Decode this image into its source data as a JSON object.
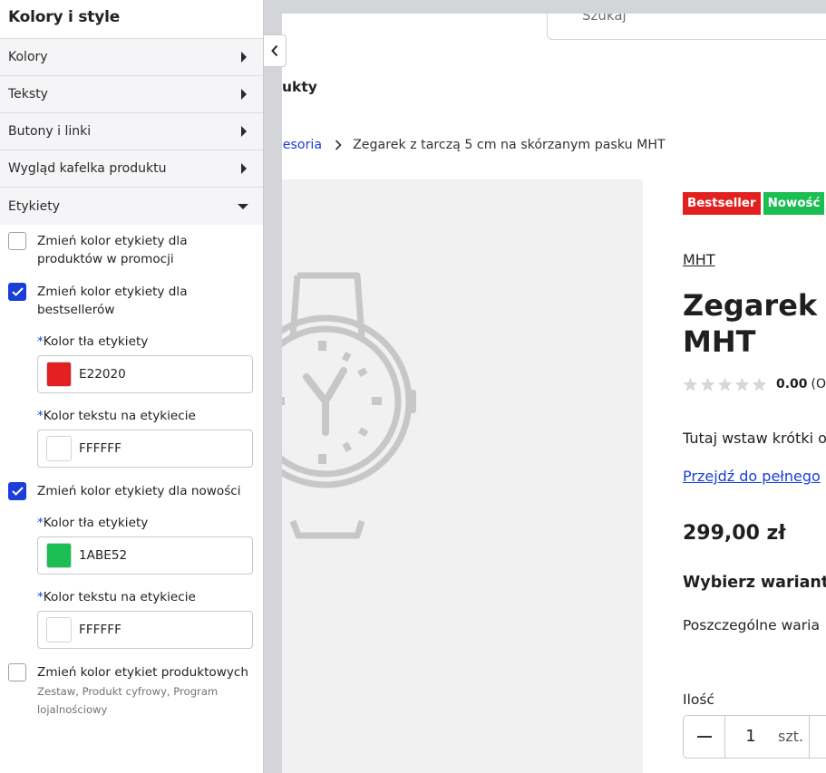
{
  "panel": {
    "title": "Kolory i style",
    "sections": [
      "Kolory",
      "Teksty",
      "Butony i linki",
      "Wygląd kafelka produktu",
      "Etykiety"
    ],
    "options": [
      {
        "label": "Zmień kolor etykiety dla produktów w promocji",
        "checked": false
      },
      {
        "label": "Zmień kolor etykiety dla bestsellerów",
        "checked": true
      },
      {
        "label": "Zmień kolor etykiety dla nowości",
        "checked": true
      },
      {
        "label": "Zmień kolor etykiet produktowych",
        "sub": "Zestaw, Produkt cyfrowy, Program lojalnościowy",
        "checked": false
      }
    ],
    "required_mark": "*",
    "fields": [
      {
        "label": "Kolor tła etykiety",
        "value": "E22020",
        "color": "#E22020"
      },
      {
        "label": "Kolor tekstu na etykiecie",
        "value": "FFFFFF",
        "color": "#FFFFFF"
      },
      {
        "label": "Kolor tła etykiety",
        "value": "1ABE52",
        "color": "#1ABE52"
      },
      {
        "label": "Kolor tekstu na etykiecie",
        "value": "FFFFFF",
        "color": "#FFFFFF"
      }
    ]
  },
  "collapse_icon": "chevron-left-icon",
  "preview": {
    "search_placeholder": "Szukaj",
    "nav_fragment": "ukty",
    "breadcrumb": {
      "link": "cesoria",
      "current": "Zegarek z tarczą 5 cm na skórzanym pasku MHT"
    },
    "badges": [
      {
        "label": "Bestseller",
        "bg": "#E22020",
        "fg": "#FFFFFF"
      },
      {
        "label": "Nowość",
        "bg": "#1ABE52",
        "fg": "#FFFFFF"
      }
    ],
    "brand": "MHT",
    "title_lines": [
      "Zegarek z",
      "MHT"
    ],
    "rating": {
      "value": "0.00",
      "count_fragment": "(O",
      "stars": 0
    },
    "short_desc": "Tutaj wstaw krótki o",
    "full_desc_link": "Przejdź do pełnego",
    "price": "299,00 zł",
    "variant_heading": "Wybierz wariant",
    "variant_text": "Poszczególne waria",
    "qty_label": "Ilość",
    "qty_value": "1",
    "qty_unit": "szt."
  }
}
